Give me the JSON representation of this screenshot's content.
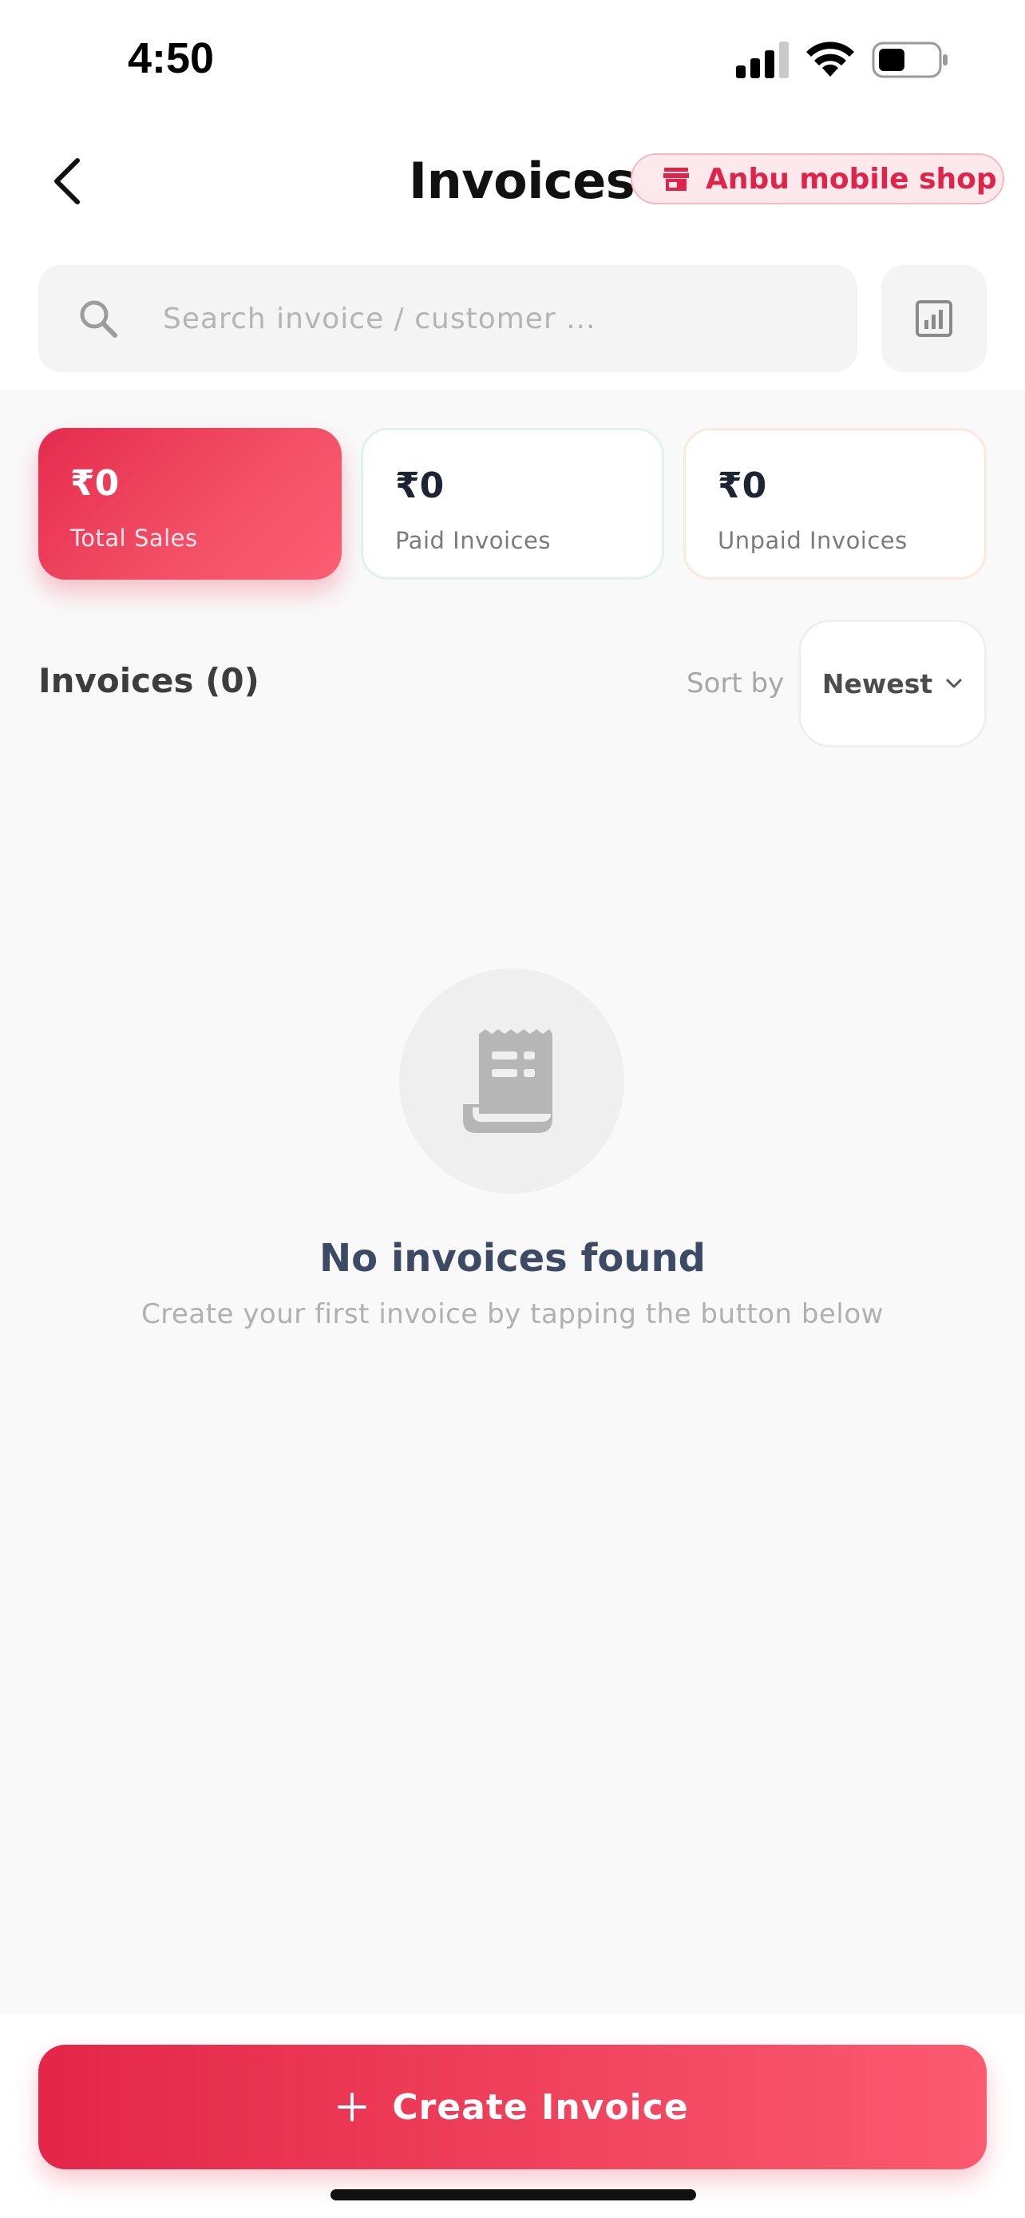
{
  "status_bar": {
    "time": "4:50"
  },
  "header": {
    "title": "Invoices",
    "shop_name": "Anbu mobile shop"
  },
  "search": {
    "placeholder": "Search invoice / customer ..."
  },
  "stats": [
    {
      "value": "₹0",
      "label": "Total Sales"
    },
    {
      "value": "₹0",
      "label": "Paid Invoices"
    },
    {
      "value": "₹0",
      "label": "Unpaid Invoices"
    }
  ],
  "list": {
    "heading": "Invoices (0)",
    "sort_label": "Sort by",
    "sort_value": "Newest"
  },
  "empty_state": {
    "icon": "receipt-icon",
    "title": "No invoices found",
    "subtitle": "Create your first invoice by tapping the button below"
  },
  "actions": {
    "create_label": "Create Invoice"
  },
  "colors": {
    "brand": "#e52c4e",
    "brand_light": "#fde8ec",
    "muted": "#b0b0b0"
  }
}
